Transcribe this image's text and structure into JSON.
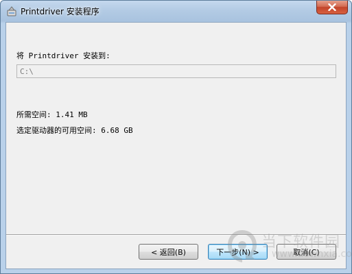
{
  "window": {
    "title": "Printdriver 安装程序",
    "close_icon": "close-x-icon",
    "app_icon": "installer-icon"
  },
  "install": {
    "label": "将 Printdriver 安装到:",
    "path_value": "C:\\"
  },
  "disk": {
    "required_text": "所需空间: 1.41 MB",
    "available_text": "选定驱动器的可用空间: 6.68 GB"
  },
  "buttons": {
    "back_label": "< 返回(B)",
    "next_label": "下一步(N) >",
    "cancel_label": "取消(C)"
  },
  "watermark": {
    "chinese": "当下软件园",
    "english": "www.downxia.com"
  },
  "colors": {
    "dialog_background": "#f0f0f0",
    "close_button": "#c2452b",
    "primary_button_border": "#3c7fb1"
  }
}
